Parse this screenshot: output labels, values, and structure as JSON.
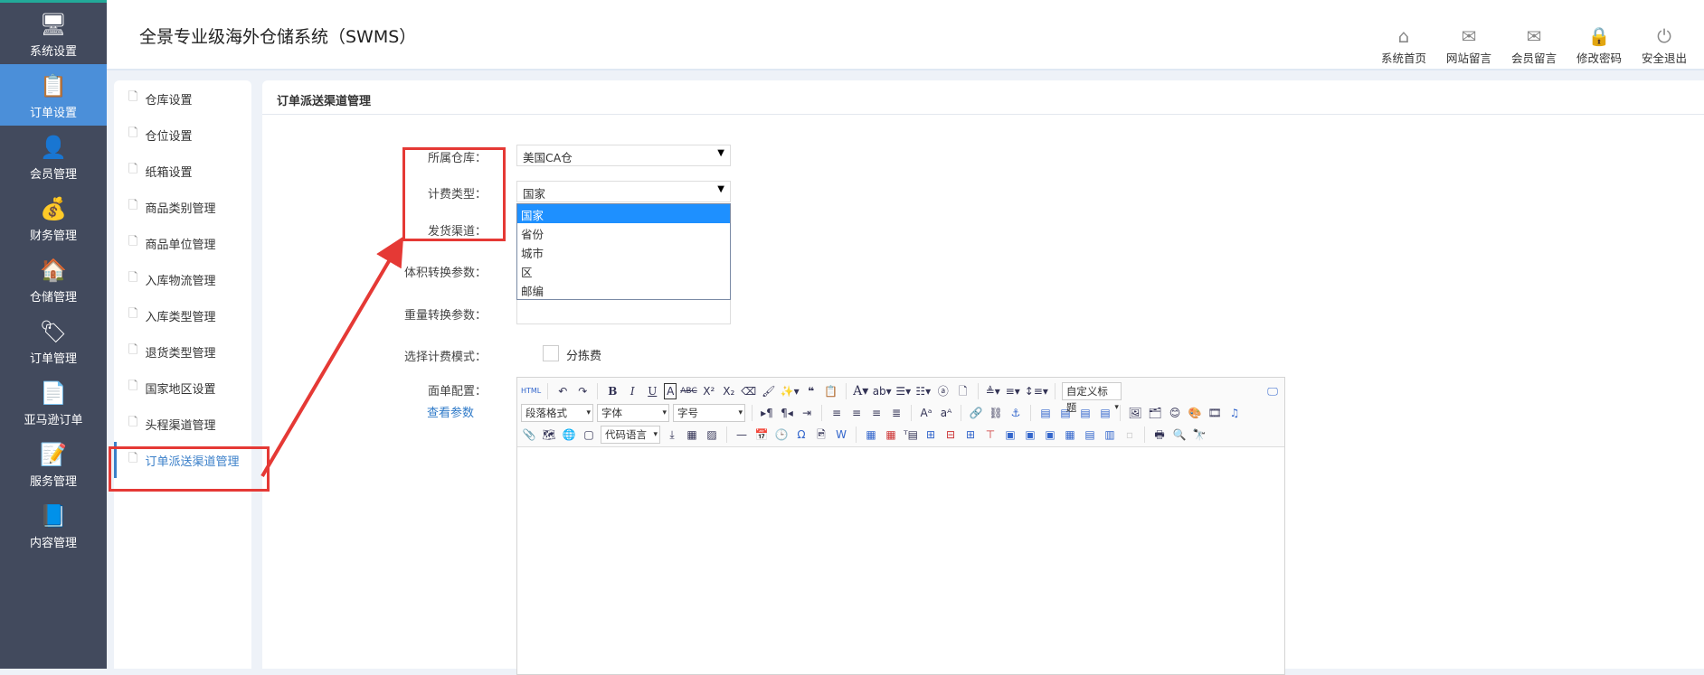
{
  "app": {
    "title": "全景专业级海外仓储系统（SWMS）"
  },
  "sidebar": {
    "items": [
      {
        "label": "系统设置",
        "icon": "monitor-gear-icon",
        "glyph": "🖥"
      },
      {
        "label": "订单设置",
        "icon": "documents-icon",
        "glyph": "📋",
        "active": true
      },
      {
        "label": "会员管理",
        "icon": "user-icon",
        "glyph": "👤"
      },
      {
        "label": "财务管理",
        "icon": "money-bag-icon",
        "glyph": "💰"
      },
      {
        "label": "仓储管理",
        "icon": "warehouse-truck-icon",
        "glyph": "🏠"
      },
      {
        "label": "订单管理",
        "icon": "tag-icon",
        "glyph": "🏷"
      },
      {
        "label": "亚马逊订单",
        "icon": "document-dollar-icon",
        "glyph": "📄"
      },
      {
        "label": "服务管理",
        "icon": "document-list-icon",
        "glyph": "📝"
      },
      {
        "label": "内容管理",
        "icon": "word-document-icon",
        "glyph": "📘"
      }
    ]
  },
  "topnav": [
    {
      "label": "系统首页",
      "icon": "home-icon",
      "glyph": "⌂"
    },
    {
      "label": "网站留言",
      "icon": "envelope-icon",
      "glyph": "✉"
    },
    {
      "label": "会员留言",
      "icon": "envelope-icon",
      "glyph": "✉"
    },
    {
      "label": "修改密码",
      "icon": "lock-icon",
      "glyph": "🔒"
    },
    {
      "label": "安全退出",
      "icon": "power-icon",
      "glyph": "⏻"
    }
  ],
  "menu": {
    "items": [
      "仓库设置",
      "仓位设置",
      "纸箱设置",
      "商品类别管理",
      "商品单位管理",
      "入库物流管理",
      "入库类型管理",
      "退货类型管理",
      "国家地区设置",
      "头程渠道管理",
      "订单派送渠道管理"
    ],
    "active": "订单派送渠道管理"
  },
  "main": {
    "heading": "订单派送渠道管理",
    "form": {
      "warehouse_label": "所属仓库：",
      "warehouse_value": "美国CA仓",
      "billing_type_label": "计费类型：",
      "billing_type_value": "国家",
      "billing_type_options": [
        "国家",
        "省份",
        "城市",
        "区",
        "邮编"
      ],
      "channel_label": "发货渠道：",
      "volume_label": "体积转换参数：",
      "volume_value": "",
      "weight_label": "重量转换参数：",
      "weight_value": "",
      "mode_label": "选择计费模式：",
      "mode_checkbox_label": "分拣费",
      "mode_checked": false,
      "template_label": "面单配置：",
      "view_params_link": "查看参数"
    },
    "editor": {
      "custom_title": "自定义标题",
      "paragraph": "段落格式",
      "font": "字体",
      "size": "字号",
      "code_lang": "代码语言",
      "html_btn": "HTML"
    }
  },
  "annotation_color": "#e53935"
}
